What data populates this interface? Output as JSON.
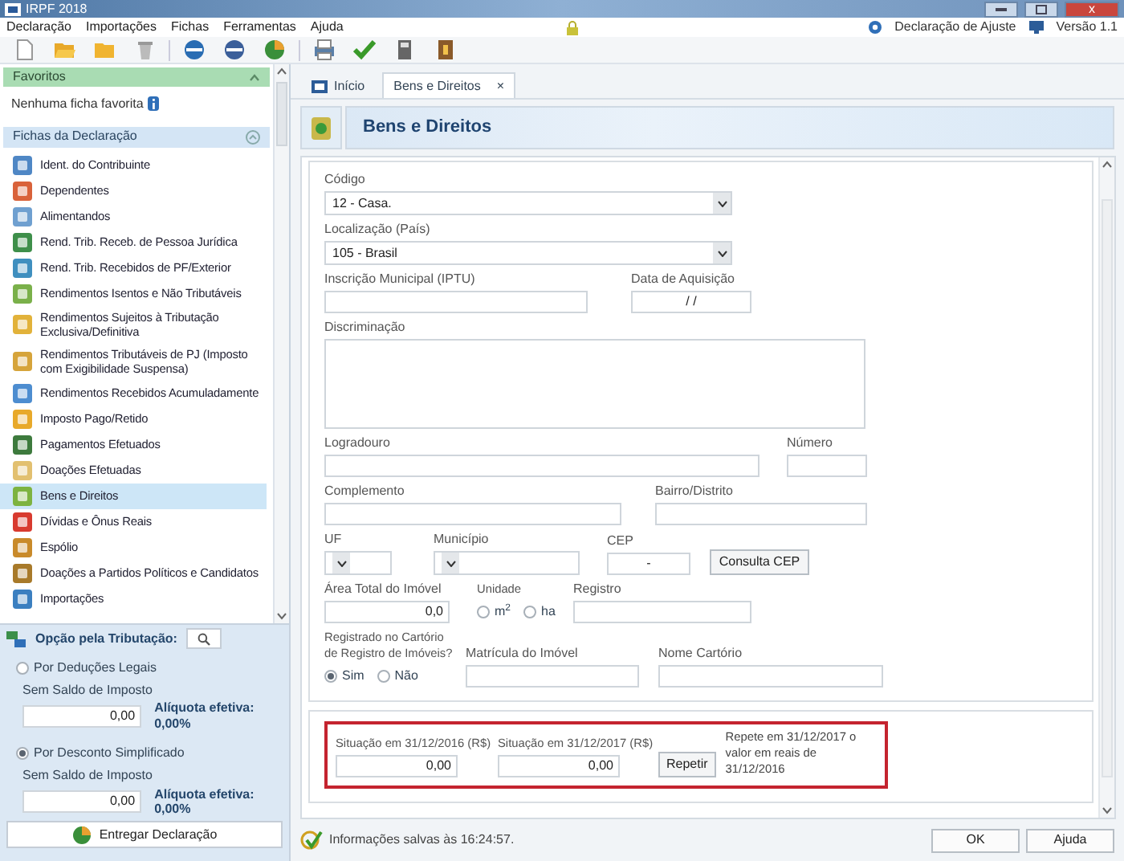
{
  "window": {
    "title": "IRPF 2018",
    "close_glyph": "x"
  },
  "menu": [
    "Declaração",
    "Importações",
    "Fichas",
    "Ferramentas",
    "Ajuda"
  ],
  "header_links": [
    "Declaração de Ajuste",
    "Versão 1.1"
  ],
  "favorites": {
    "title": "Favoritos",
    "empty_text": "Nenhuma ficha favorita"
  },
  "fichas": {
    "title": "Fichas da Declaração",
    "items": [
      {
        "label": "Ident. do Contribuinte",
        "selected": false
      },
      {
        "label": "Dependentes",
        "selected": false
      },
      {
        "label": "Alimentandos",
        "selected": false
      },
      {
        "label": "Rend. Trib. Receb. de Pessoa Jurídica",
        "selected": false
      },
      {
        "label": "Rend. Trib. Recebidos de PF/Exterior",
        "selected": false
      },
      {
        "label": "Rendimentos Isentos e Não Tributáveis",
        "selected": false
      },
      {
        "label": "Rendimentos Sujeitos à Tributação Exclusiva/Definitiva",
        "selected": false
      },
      {
        "label": "Rendimentos Tributáveis de PJ (Imposto com Exigibilidade Suspensa)",
        "selected": false
      },
      {
        "label": "Rendimentos Recebidos Acumuladamente",
        "selected": false
      },
      {
        "label": "Imposto Pago/Retido",
        "selected": false
      },
      {
        "label": "Pagamentos Efetuados",
        "selected": false
      },
      {
        "label": "Doações Efetuadas",
        "selected": false
      },
      {
        "label": "Bens e Direitos",
        "selected": true
      },
      {
        "label": "Dívidas e Ônus Reais",
        "selected": false
      },
      {
        "label": "Espólio",
        "selected": false
      },
      {
        "label": "Doações a Partidos Políticos e Candidatos",
        "selected": false
      },
      {
        "label": "Importações",
        "selected": false
      }
    ]
  },
  "tributacao": {
    "title": "Opção pela Tributação:",
    "options": [
      {
        "label": "Por Deduções Legais",
        "selected": false,
        "saldo_label": "Sem Saldo de Imposto",
        "value": "0,00",
        "aliquota": "Alíquota efetiva: 0,00%"
      },
      {
        "label": "Por Desconto Simplificado",
        "selected": true,
        "saldo_label": "Sem Saldo de Imposto",
        "value": "0,00",
        "aliquota": "Alíquota efetiva: 0,00%"
      }
    ]
  },
  "deliver_button": "Entregar Declaração",
  "tabs": [
    {
      "label": "Início",
      "selected": false,
      "closable": false
    },
    {
      "label": "Bens e Direitos",
      "selected": true,
      "closable": true
    }
  ],
  "close_tab_glyph": "×",
  "page_title": "Bens e Direitos",
  "form": {
    "rows": [
      [
        {
          "kind": "select",
          "label": "Código",
          "value": "12 - Casa."
        }
      ],
      [
        {
          "kind": "select",
          "label": "Localização (País)",
          "value": "105 - Brasil"
        }
      ],
      [
        {
          "kind": "input",
          "label": "Inscrição Municipal (IPTU)"
        },
        {
          "kind": "input",
          "label": "Data de Aquisição",
          "value": "/ /"
        }
      ],
      [
        {
          "kind": "textarea",
          "label": "Discriminação"
        }
      ],
      [
        {
          "kind": "input",
          "label": "Logradouro"
        },
        {
          "kind": "input",
          "label": "Número"
        }
      ],
      [
        {
          "kind": "input",
          "label": "Complemento"
        },
        {
          "kind": "input",
          "label": "Bairro/Distrito"
        }
      ],
      [
        {
          "kind": "select",
          "label": "UF"
        },
        {
          "kind": "select",
          "label": "Município"
        },
        {
          "kind": "input",
          "label": "CEP",
          "value": "-"
        },
        {
          "kind": "button",
          "label": "Consulta CEP"
        }
      ],
      [
        {
          "kind": "input",
          "label": "Área Total do Imóvel",
          "value": "0,0"
        },
        {
          "kind": "radio_group",
          "label": "Unidade",
          "options": [
            {
              "label": "m$^{2}$",
              "selected": false
            },
            {
              "label": "ha",
              "selected": false
            }
          ]
        },
        {
          "kind": "input",
          "label": "Registro"
        }
      ],
      [
        {
          "kind": "radio_group",
          "label": "Registrado no Cartório de Registro de Imóveis?",
          "options": [
            {
              "label": "Sim",
              "selected": true
            },
            {
              "label": "Não",
              "selected": false
            }
          ]
        },
        {
          "kind": "input",
          "label": "Matrícula do Imóvel"
        },
        {
          "kind": "input",
          "label": "Nome Cartório"
        }
      ]
    ]
  },
  "situacao": {
    "highlighted": true,
    "fields": [
      {
        "label": "Situação em 31/12/2016 (R$)",
        "value": "0,00"
      },
      {
        "label": "Situação em 31/12/2017 (R$)",
        "value": "0,00"
      }
    ],
    "button": "Repetir",
    "note": "Repete em 31/12/2017 o valor em reais de 31/12/2016"
  },
  "status": {
    "text": "Informações salvas às 16:24:57.",
    "buttons": [
      "OK",
      "Ajuda"
    ]
  }
}
